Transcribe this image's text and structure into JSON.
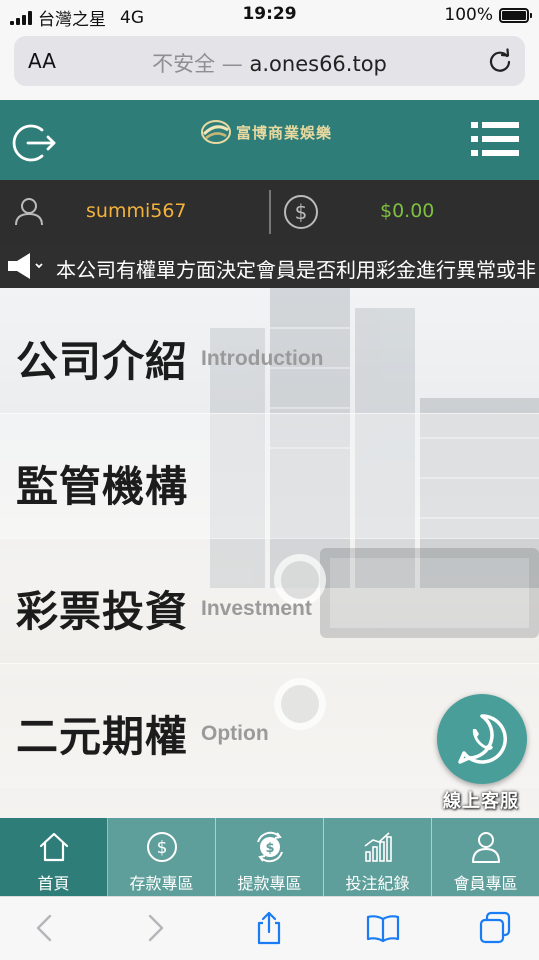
{
  "status_bar": {
    "carrier": "台灣之星",
    "network": "4G",
    "time": "19:29",
    "battery": "100%"
  },
  "browser": {
    "aa_label": "AA",
    "insecure_label": "不安全 —",
    "domain": "a.ones66.top"
  },
  "header": {
    "logo_text": "富博商業娛樂"
  },
  "user": {
    "username": "summi567",
    "balance": "$0.00"
  },
  "announcement": {
    "text": "本公司有權單方面決定會員是否利用彩金進行異常或非"
  },
  "sections": [
    {
      "title": "公司介紹",
      "subtitle": "Introduction"
    },
    {
      "title": "監管機構",
      "subtitle": ""
    },
    {
      "title": "彩票投資",
      "subtitle": "Investment"
    },
    {
      "title": "二元期權",
      "subtitle": "Option"
    }
  ],
  "chat": {
    "label": "線上客服"
  },
  "bottom_nav": [
    {
      "label": "首頁",
      "icon": "home-icon",
      "active": true
    },
    {
      "label": "存款專區",
      "icon": "deposit-icon",
      "active": false
    },
    {
      "label": "提款專區",
      "icon": "withdraw-icon",
      "active": false
    },
    {
      "label": "投注紀錄",
      "icon": "bet-record-icon",
      "active": false
    },
    {
      "label": "會員專區",
      "icon": "member-icon",
      "active": false
    }
  ],
  "colors": {
    "brand_teal": "#2e7d78",
    "nav_teal": "#5f9f9b",
    "username": "#f3b23a",
    "balance": "#7fbf3f"
  }
}
